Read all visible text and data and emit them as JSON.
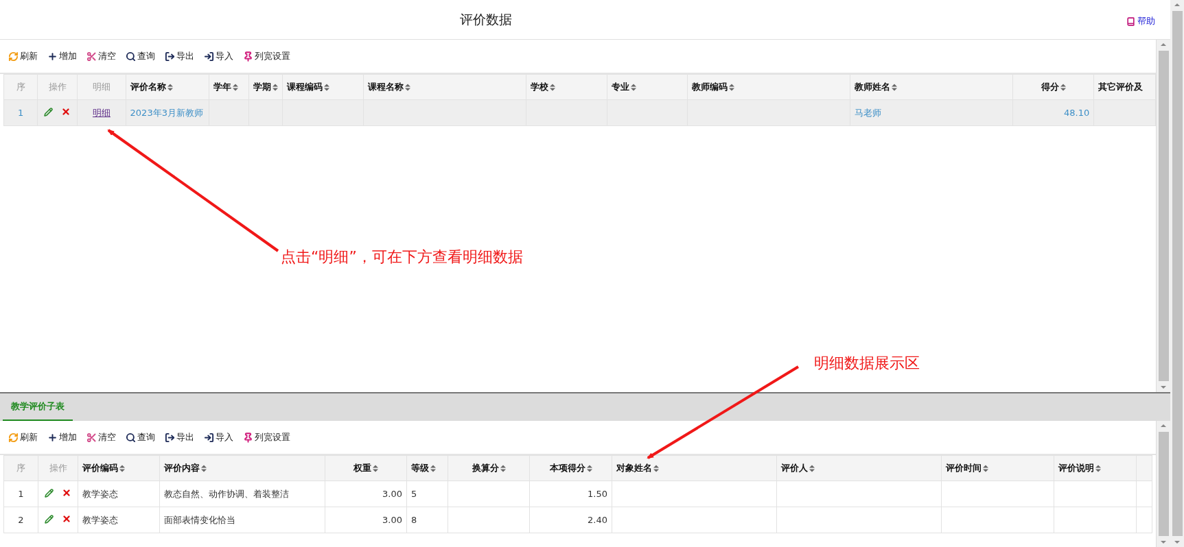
{
  "header": {
    "title": "评价数据",
    "help": "帮助"
  },
  "main": {
    "toolbar": [
      {
        "kind": "refresh",
        "label": "刷新"
      },
      {
        "kind": "add",
        "label": "增加"
      },
      {
        "kind": "clear",
        "label": "清空"
      },
      {
        "kind": "query",
        "label": "查询"
      },
      {
        "kind": "export",
        "label": "导出"
      },
      {
        "kind": "import",
        "label": "导入"
      },
      {
        "kind": "columns",
        "label": "列宽设置"
      }
    ],
    "columns": [
      {
        "label": "序",
        "kind": "index",
        "sortable": false
      },
      {
        "label": "操作",
        "kind": "action",
        "sortable": false
      },
      {
        "label": "明细",
        "kind": "link",
        "sortable": false
      },
      {
        "label": "评价名称",
        "kind": "text",
        "sortable": true
      },
      {
        "label": "学年",
        "kind": "text",
        "sortable": true
      },
      {
        "label": "学期",
        "kind": "text",
        "sortable": true
      },
      {
        "label": "课程编码",
        "kind": "text",
        "sortable": true
      },
      {
        "label": "课程名称",
        "kind": "text",
        "sortable": true
      },
      {
        "label": "学校",
        "kind": "text",
        "sortable": true
      },
      {
        "label": "专业",
        "kind": "text",
        "sortable": true
      },
      {
        "label": "教师编码",
        "kind": "text",
        "sortable": true
      },
      {
        "label": "教师姓名",
        "kind": "text",
        "sortable": true
      },
      {
        "label": "得分",
        "kind": "number",
        "sortable": true
      },
      {
        "label": "其它评价及",
        "kind": "text",
        "sortable": false
      }
    ],
    "rows": [
      {
        "selected": true,
        "cells": [
          "1",
          null,
          "明细",
          "2023年3月新教师",
          null,
          null,
          null,
          null,
          null,
          null,
          null,
          "马老师",
          "48.10",
          null
        ]
      }
    ]
  },
  "detail": {
    "tabs": [
      {
        "label": "教学评价子表",
        "selected": true
      }
    ],
    "toolbar": [
      {
        "kind": "refresh",
        "label": "刷新"
      },
      {
        "kind": "add",
        "label": "增加"
      },
      {
        "kind": "clear",
        "label": "清空"
      },
      {
        "kind": "query",
        "label": "查询"
      },
      {
        "kind": "export",
        "label": "导出"
      },
      {
        "kind": "import",
        "label": "导入"
      },
      {
        "kind": "columns",
        "label": "列宽设置"
      }
    ],
    "columns": [
      {
        "label": "序",
        "kind": "index",
        "sortable": false
      },
      {
        "label": "操作",
        "kind": "action",
        "sortable": false
      },
      {
        "label": "评价编码",
        "kind": "text",
        "sortable": true
      },
      {
        "label": "评价内容",
        "kind": "text",
        "sortable": true
      },
      {
        "label": "权重",
        "kind": "number",
        "sortable": true
      },
      {
        "label": "等级",
        "kind": "text",
        "sortable": true
      },
      {
        "label": "换算分",
        "kind": "number",
        "sortable": true
      },
      {
        "label": "本项得分",
        "kind": "number",
        "sortable": true
      },
      {
        "label": "对象姓名",
        "kind": "text",
        "sortable": true
      },
      {
        "label": "评价人",
        "kind": "text",
        "sortable": true
      },
      {
        "label": "评价时间",
        "kind": "text",
        "sortable": true
      },
      {
        "label": "评价说明",
        "kind": "text",
        "sortable": true
      },
      {
        "kind": "text",
        "sortable": false
      }
    ],
    "rows": [
      {
        "selected": false,
        "cells": [
          "1",
          null,
          "教学姿态",
          "教态自然、动作协调、着装整洁",
          "3.00",
          "5",
          null,
          "1.50",
          null,
          null,
          null,
          null,
          null
        ]
      },
      {
        "selected": false,
        "cells": [
          "2",
          null,
          "教学姿态",
          "面部表情变化恰当",
          "3.00",
          "8",
          null,
          "2.40",
          null,
          null,
          null,
          null,
          null
        ]
      }
    ]
  },
  "annotations": [
    {
      "kind": "arrow-note",
      "text": "点击“明细”，可在下方查看明细数据"
    },
    {
      "kind": "arrow-note",
      "text": "明细数据展示区"
    }
  ]
}
